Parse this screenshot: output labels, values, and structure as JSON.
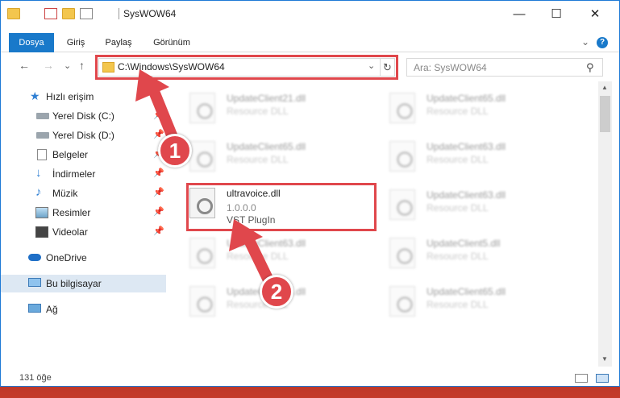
{
  "window": {
    "title": "SysWOW64",
    "minimize_glyph": "—",
    "maximize_glyph": "☐",
    "close_glyph": "✕"
  },
  "ribbon": {
    "tabs": [
      "Dosya",
      "Giriş",
      "Paylaş",
      "Görünüm"
    ],
    "expand_glyph": "⌄",
    "help_glyph": "?"
  },
  "address": {
    "back_glyph": "←",
    "forward_glyph": "→",
    "recent_glyph": "⌄",
    "up_glyph": "↑",
    "path": "C:\\Windows\\SysWOW64",
    "dropdown_glyph": "⌄",
    "refresh_glyph": "↻"
  },
  "search": {
    "placeholder": "Ara: SysWOW64",
    "icon_glyph": "⚲"
  },
  "nav": {
    "items": [
      {
        "label": "Hızlı erişim",
        "icon": "star-icon"
      },
      {
        "label": "Yerel Disk (C:)",
        "icon": "drive-icon"
      },
      {
        "label": "Yerel Disk (D:)",
        "icon": "drive-icon"
      },
      {
        "label": "Belgeler",
        "icon": "documents-icon"
      },
      {
        "label": "İndirmeler",
        "icon": "download-icon"
      },
      {
        "label": "Müzik",
        "icon": "music-icon"
      },
      {
        "label": "Resimler",
        "icon": "pictures-icon"
      },
      {
        "label": "Videolar",
        "icon": "videos-icon"
      },
      {
        "label": "OneDrive",
        "icon": "cloud-icon"
      },
      {
        "label": "Bu bilgisayar",
        "icon": "computer-icon"
      },
      {
        "label": "Ağ",
        "icon": "network-icon"
      }
    ],
    "pin_glyph": "📌"
  },
  "files": [
    {
      "name": "UpdateClient21.dll",
      "type": "Resource DLL"
    },
    {
      "name": "UpdateClient65.dll",
      "type": "Resource DLL"
    },
    {
      "name": "UpdateClient65.dll",
      "type": "Resource DLL"
    },
    {
      "name": "UpdateClient63.dll",
      "type": "Resource DLL"
    },
    {
      "name": "UpdateClient63.dll",
      "type": "Resource DLL"
    },
    {
      "name": "UpdateClient5.dll",
      "type": "Resource DLL"
    },
    {
      "name": "UpdateClient65.dll",
      "type": "Resource DLL"
    },
    {
      "name": "UpdateClient65.dll",
      "type": "Resource DLL"
    }
  ],
  "highlighted_file": {
    "name": "ultravoice.dll",
    "version": "1.0.0.0",
    "type": "VST PlugIn"
  },
  "status": {
    "count": "131 öğe"
  },
  "callouts": {
    "step1": "1",
    "step2": "2",
    "color": "#e0474c"
  },
  "scroll": {
    "up_glyph": "▲",
    "down_glyph": "▼"
  }
}
